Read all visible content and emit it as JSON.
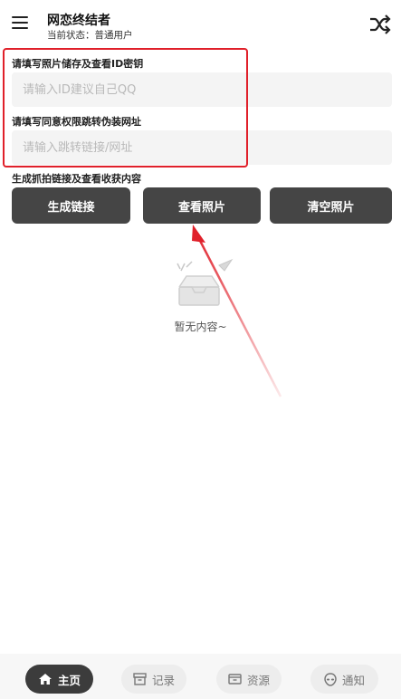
{
  "header": {
    "title": "网恋终结者",
    "status": "当前状态：普通用户"
  },
  "form": {
    "id_label": "请填写照片储存及查看ID密钥",
    "id_placeholder": "请输入ID建议自己QQ",
    "url_label": "请填写同意权限跳转伪装网址",
    "url_placeholder": "请输入跳转链接/网址",
    "actions_label": "生成抓拍链接及查看收获内容"
  },
  "buttons": {
    "generate": "生成链接",
    "view": "查看照片",
    "clear": "清空照片"
  },
  "empty": {
    "text": "暂无内容~"
  },
  "bottom_nav": [
    {
      "label": "主页",
      "icon": "home-icon",
      "active": true
    },
    {
      "label": "记录",
      "icon": "archive-icon",
      "active": false
    },
    {
      "label": "资源",
      "icon": "folder-icon",
      "active": false
    },
    {
      "label": "通知",
      "icon": "alien-icon",
      "active": false
    }
  ],
  "colors": {
    "button_bg": "#454545",
    "highlight_red": "#e0202a",
    "input_bg": "#f4f4f4",
    "nav_active": "#3c3c3c"
  }
}
